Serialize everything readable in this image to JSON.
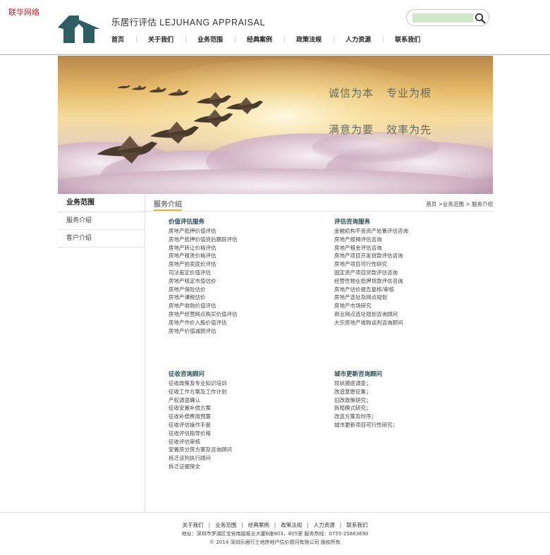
{
  "corner_tag": "联华网络",
  "brand": {
    "cn": "乐居行评估",
    "en": "LEJUHANG APPRAISAL"
  },
  "search": {
    "placeholder": "",
    "icon": "search-icon"
  },
  "nav": [
    "首页",
    "关于我们",
    "业务范围",
    "经典案例",
    "政策法规",
    "人力资源",
    "联系我们"
  ],
  "banner": {
    "slogans": [
      "诚信为本",
      "专业为根",
      "满意为要",
      "效率为先"
    ]
  },
  "sidebar": {
    "title": "业务范围",
    "items": [
      "服务介绍",
      "客户介绍"
    ]
  },
  "content": {
    "title": "服务介绍",
    "breadcrumb": [
      "首页",
      ">业务范围",
      ">",
      "服务介绍"
    ],
    "groups": [
      {
        "title": "价值评估服务",
        "items": [
          "房地产抵押价值评估",
          "房地产抵押价值贷后跟踪评估",
          "房地产转让价格评估",
          "房地产租赁价格评估",
          "房地产拍卖底价评估",
          "司法鉴定价值评估",
          "房地产核定市值估价",
          "房地产保险估价",
          "房地产课税估价",
          "房地产收购价值评估",
          "房地产经营网点购买价值评估",
          "房地产作价入股价值评估",
          "房地产价值减损评估"
        ]
      },
      {
        "title": "评估咨询服务",
        "items": [
          "金融机构不良资产处置评估咨询",
          "房地产按揭评估咨询",
          "房地产租金评估咨询",
          "房地产项目开发贷款评估咨询",
          "房地产项目可行性研究",
          "固定资产项目贷款评估咨询",
          "经营性物业抵押贷款评估咨询",
          "房地产估价报告复核/审核",
          "房地产选址及网点规划",
          "房地产市场研究",
          "商业网点选址规划咨询顾问",
          "大宗房地产收购谈判咨询顾问"
        ]
      },
      {
        "title": "征收咨询顾问",
        "items": [
          "征收政策及专业知识培训",
          "征收工作方案及工作计划",
          "产权调查确认",
          "征收安置补偿方案",
          "征收补偿费用预算",
          "征收评估操作手册",
          "征收评估指导价格",
          "征收评估审核",
          "安置房分房方案及咨询顾问",
          "拆迁谈判执行顾问",
          "拆迁证据保全"
        ]
      },
      {
        "title": "城市更新咨询顾问",
        "items": [
          "现状摸底调查；",
          "改造意愿征集；",
          "旧改政策研究；",
          "拆赔模式研究；",
          "改造方案及时序；",
          "城市更新项目可行性研究；"
        ]
      }
    ]
  },
  "footer": {
    "links": [
      "关于我们",
      "业务范围",
      "经典案例",
      "政策法规",
      "人力资源",
      "联系我们"
    ],
    "address": "地址：深圳市罗湖区宝安南路振业大厦B座803、805室  服务热线：0755-25863690",
    "copyright": "© 2014  深圳乐居行土地房地产估价顾问有限公司  版权所有"
  },
  "colors": {
    "accent_green": "#2e5d62",
    "nav_rule": "#d9a0a0",
    "tab_underline": "#e6b733",
    "group_title": "#2a4c56",
    "corner_tag": "#e0141e"
  }
}
